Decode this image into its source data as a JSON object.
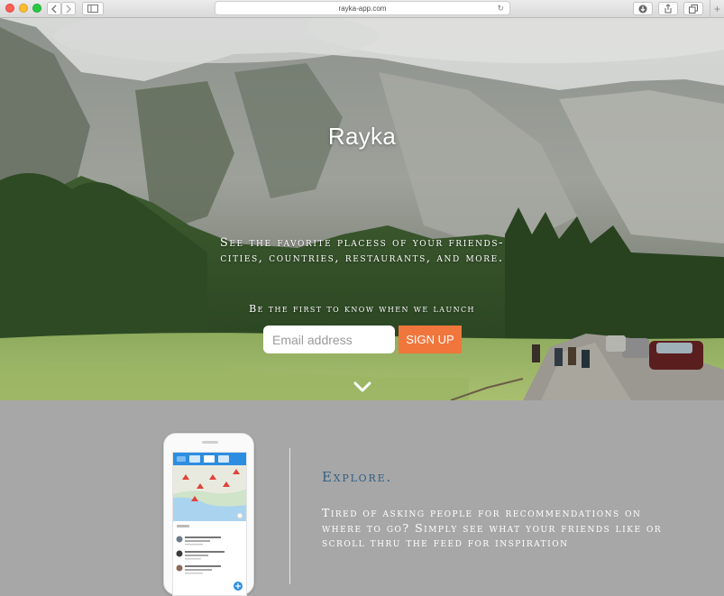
{
  "browser": {
    "url": "rayka-app.com",
    "icons": {
      "back": "chevron-left-icon",
      "forward": "chevron-right-icon",
      "sidebar": "sidebar-icon",
      "reload": "reload-icon",
      "download": "download-icon",
      "share": "share-icon",
      "tabs": "tabs-icon",
      "new_tab": "plus-icon"
    }
  },
  "hero": {
    "title": "Rayka",
    "tagline_line1": "See the favorite placess of your friends-",
    "tagline_line2": "cities, countries, restaurants, and more.",
    "notify": "Be the first to know when we launch",
    "email_placeholder": "Email address",
    "signup_label": "SIGN UP",
    "scroll_icon": "chevron-down-icon"
  },
  "feature": {
    "heading": "Explore.",
    "description": "Tired of asking people for recommendations on where to go? Simply see what your friends like or scroll thru the feed for inspiration"
  },
  "colors": {
    "accent": "#f0763c",
    "heading": "#2f5f85",
    "section_bg": "#a7a7a7"
  }
}
